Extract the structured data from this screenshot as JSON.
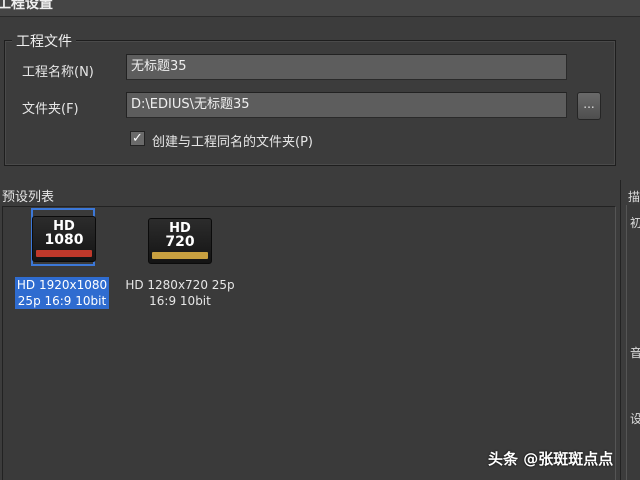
{
  "window": {
    "title": "工程设置"
  },
  "project_group": {
    "legend": "工程文件",
    "name_label": "工程名称(N)",
    "name_value": "无标题35",
    "folder_label": "文件夹(F)",
    "folder_value": "D:\\EDIUS\\无标题35",
    "browse_label": "...",
    "create_folder_checked": true,
    "create_folder_label": "创建与工程同名的文件夹(P)"
  },
  "presets": {
    "label": "预设列表",
    "items": [
      {
        "badge": "HD",
        "resolution": "1080",
        "stripe_color": "#c0392b",
        "caption": "HD 1920x1080\n25p 16:9 10bit",
        "selected": true
      },
      {
        "badge": "HD",
        "resolution": "720",
        "stripe_color": "#c8a040",
        "caption": "HD 1280x720 25p\n16:9 10bit",
        "selected": false
      }
    ]
  },
  "right_panel": {
    "glyphs": [
      "描",
      "初",
      "音",
      "设"
    ]
  },
  "watermark": "头条 @张斑斑点点"
}
